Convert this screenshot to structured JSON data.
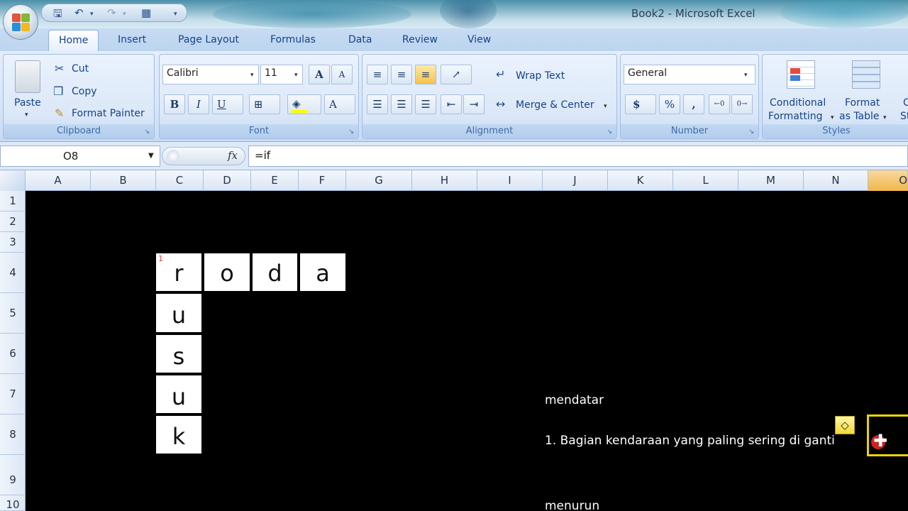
{
  "window": {
    "title": "Book2 - Microsoft Excel"
  },
  "tabs": [
    "Home",
    "Insert",
    "Page Layout",
    "Formulas",
    "Data",
    "Review",
    "View"
  ],
  "clipboard": {
    "paste": "Paste",
    "cut": "Cut",
    "copy": "Copy",
    "format_painter": "Format Painter",
    "label": "Clipboard"
  },
  "font": {
    "name": "Calibri",
    "size": "11",
    "bold": "B",
    "italic": "I",
    "underline": "U",
    "grow": "A",
    "shrink": "A",
    "font_color": "A",
    "label": "Font"
  },
  "alignment": {
    "wrap_text": "Wrap Text",
    "merge_center": "Merge & Center",
    "label": "Alignment"
  },
  "number": {
    "format": "General",
    "currency": "$",
    "percent": "%",
    "comma": ",",
    "label": "Number"
  },
  "styles": {
    "conditional": "Conditional",
    "formatting": "Formatting",
    "format": "Format",
    "as_table": "as Table",
    "cell_styles_1": "C",
    "cell_styles_2": "Sty",
    "label": "Styles"
  },
  "formula_bar": {
    "name_box": "O8",
    "fx": "fx",
    "formula": "=if"
  },
  "columns": [
    "A",
    "B",
    "C",
    "D",
    "E",
    "F",
    "G",
    "H",
    "I",
    "J",
    "K",
    "L",
    "M",
    "N",
    "O"
  ],
  "rows": [
    "1",
    "2",
    "3",
    "4",
    "5",
    "6",
    "7",
    "8",
    "9",
    "10"
  ],
  "crossword": {
    "number": "1",
    "across": [
      "r",
      "o",
      "d",
      "a"
    ],
    "down": [
      "u",
      "s",
      "u",
      "k"
    ]
  },
  "notes": {
    "mendatar": "mendatar",
    "clue1": "1. Bagian kendaraan yang paling sering di ganti",
    "menurun": "menurun"
  }
}
